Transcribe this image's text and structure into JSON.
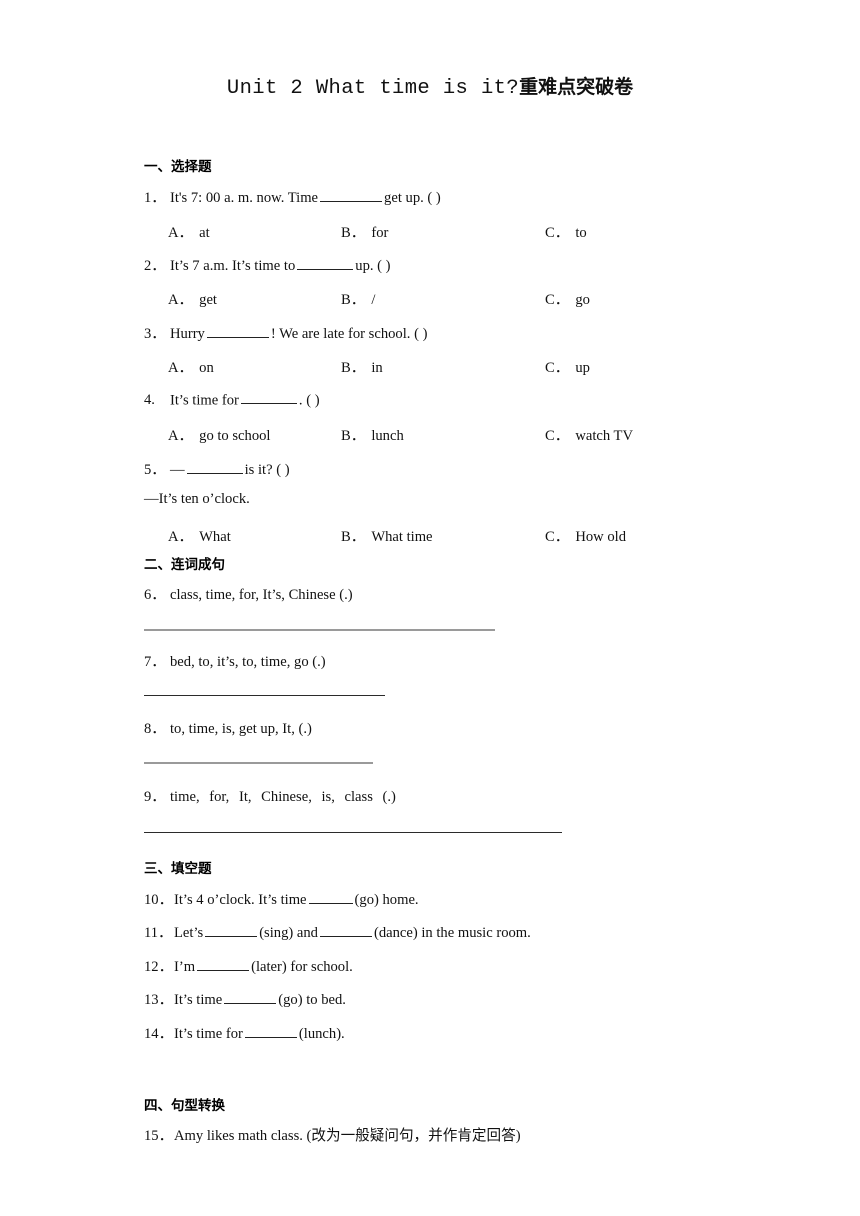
{
  "document": {
    "title_latin": "Unit 2 What time is it?",
    "title_cn": "重难点突破卷"
  },
  "sections": [
    {
      "heading": "一、选择题",
      "type": "multiple-choice",
      "questions": [
        {
          "number": "1．",
          "stem_before": "It's 7: 00 a. m. now. Time",
          "stem_after": "get up. (    )",
          "options": [
            {
              "label": "A．",
              "text": "at"
            },
            {
              "label": "B．",
              "text": "for"
            },
            {
              "label": "C．",
              "text": "to"
            }
          ]
        },
        {
          "number": "2．",
          "stem_before": "It’s 7 a.m. It’s time to",
          "stem_after": "up. (   )",
          "options": [
            {
              "label": "A．",
              "text": "get"
            },
            {
              "label": "B．",
              "text": "/"
            },
            {
              "label": "C．",
              "text": "go"
            }
          ]
        },
        {
          "number": "3．",
          "stem_before": "Hurry",
          "stem_after": "! We are late for school. (   )",
          "options": [
            {
              "label": "A．",
              "text": "on"
            },
            {
              "label": "B．",
              "text": "in"
            },
            {
              "label": "C．",
              "text": "up"
            }
          ]
        },
        {
          "number": "4.",
          "stem_before": "It’s time for",
          "stem_after": ". (      )",
          "options": [
            {
              "label": "A．",
              "text": "go to school"
            },
            {
              "label": "B．",
              "text": "lunch"
            },
            {
              "label": "C．",
              "text": "watch TV"
            }
          ]
        },
        {
          "number": "5．",
          "stem_before": "—",
          "stem_after": "is it? (   )",
          "answer_line": "—It’s ten o’clock.",
          "options": [
            {
              "label": "A．",
              "text": "What"
            },
            {
              "label": "B．",
              "text": "What time"
            },
            {
              "label": "C．",
              "text": "How old"
            }
          ]
        }
      ]
    },
    {
      "heading": "二、连词成句",
      "type": "sentence-ordering",
      "questions": [
        {
          "number": "6．",
          "text": "class, time, for, It’s, Chinese (.)"
        },
        {
          "number": "7．",
          "text": "bed, to, it’s, to, time, go (.)"
        },
        {
          "number": "8．",
          "text": "to, time, is, get up, It, (.)"
        },
        {
          "number": "9．",
          "text": "time,  for,  It,  Chinese,  is,  class  (.)"
        }
      ]
    },
    {
      "heading": "三、填空题",
      "type": "fill-in-the-blank",
      "questions": [
        {
          "number": "10．",
          "parts": [
            "It’s 4 o’clock. It’s time",
            "(go) home."
          ]
        },
        {
          "number": "11．",
          "parts": [
            "Let’s",
            "(sing) and",
            "(dance) in the music room."
          ]
        },
        {
          "number": "12．",
          "parts": [
            "I’m",
            "(later) for school."
          ]
        },
        {
          "number": "13．",
          "parts": [
            "It’s time",
            "(go) to bed."
          ]
        },
        {
          "number": "14．",
          "parts": [
            "It’s time for",
            "(lunch)."
          ]
        }
      ]
    },
    {
      "heading": "四、句型转换",
      "type": "sentence-transformation",
      "questions": [
        {
          "number": "15．",
          "text": "Amy likes math class. (改为一般疑问句，并作肯定回答)"
        }
      ]
    }
  ],
  "colors": {
    "text": "#111111",
    "rule_gray": "#9a9a9a",
    "rule_dark": "#2b2b2b",
    "background": "#ffffff"
  }
}
